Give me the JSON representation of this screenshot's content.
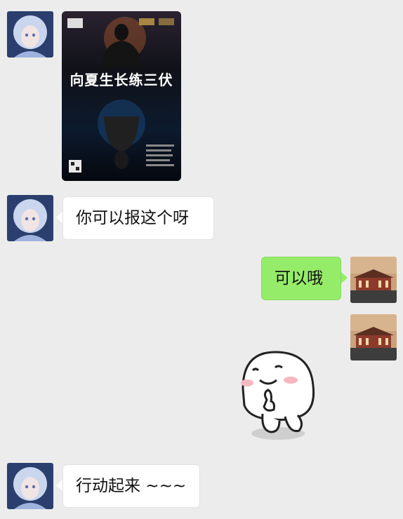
{
  "conversation": {
    "messages": [
      {
        "sender": "left",
        "type": "image",
        "poster": {
          "title": "向夏生长练三伏"
        }
      },
      {
        "sender": "left",
        "type": "text",
        "text": "你可以报这个呀"
      },
      {
        "sender": "right",
        "type": "text",
        "text": "可以哦"
      },
      {
        "sender": "right",
        "type": "sticker",
        "sticker": "shy-smiling-bun-sticker"
      },
      {
        "sender": "left",
        "type": "text",
        "text": "行动起来 ~~~"
      }
    ]
  },
  "colors": {
    "background": "#ececec",
    "bubble_left": "#ffffff",
    "bubble_right": "#95ec69"
  },
  "icons": {
    "left_avatar": "anime-girl-avatar",
    "right_avatar": "building-photo-avatar"
  }
}
